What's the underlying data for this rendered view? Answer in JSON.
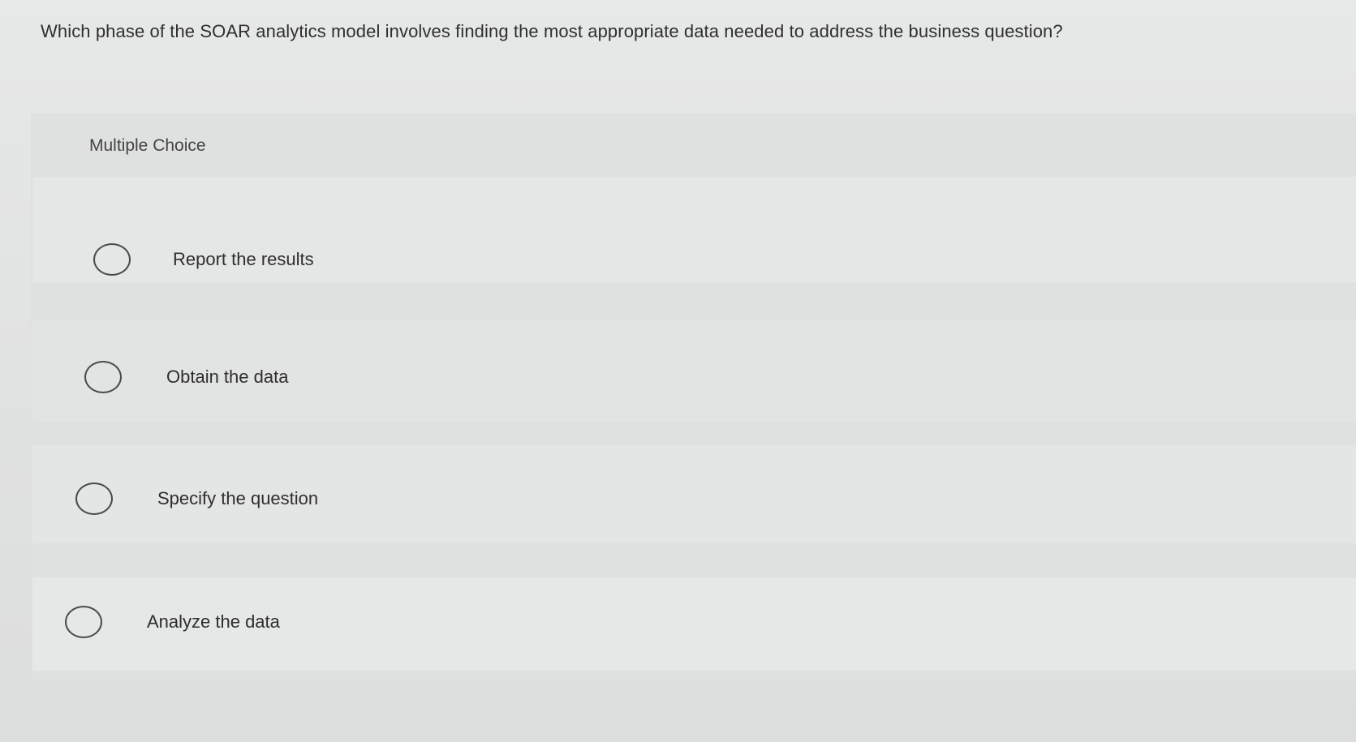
{
  "question": {
    "text": "Which phase of the SOAR analytics model involves finding the most appropriate data needed to address the business question?"
  },
  "section": {
    "label": "Multiple Choice"
  },
  "options": [
    {
      "label": "Report the results"
    },
    {
      "label": "Obtain the data"
    },
    {
      "label": "Specify the question"
    },
    {
      "label": "Analyze the data"
    }
  ]
}
